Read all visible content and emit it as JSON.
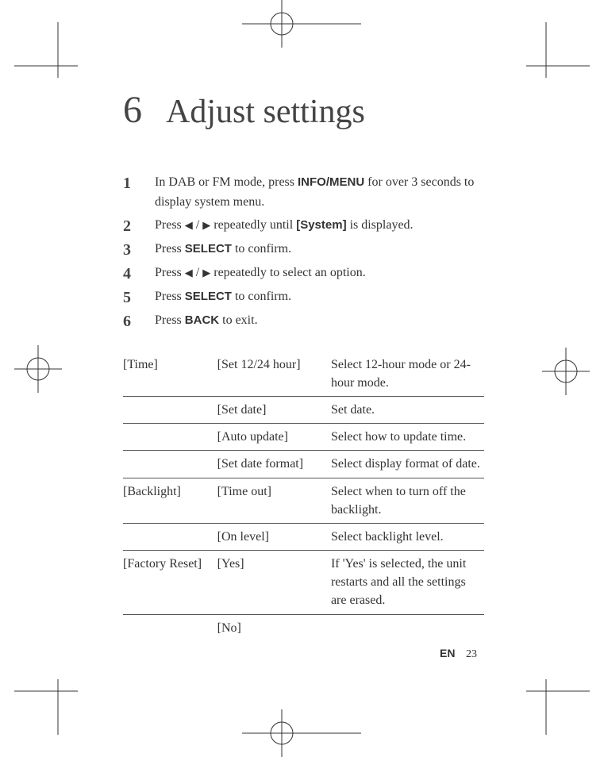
{
  "chapter": {
    "number": "6",
    "title": "Adjust settings"
  },
  "steps": [
    {
      "n": "1",
      "pre": "In DAB or FM mode, press ",
      "bold": "INFO/MENU",
      "post": " for over 3 seconds to display system menu."
    },
    {
      "n": "2",
      "pre": "Press ",
      "icons": true,
      "mid": " repeatedly until ",
      "bold": "[System]",
      "post": " is displayed."
    },
    {
      "n": "3",
      "pre": "Press ",
      "bold": "SELECT",
      "post": " to confirm."
    },
    {
      "n": "4",
      "pre": "Press ",
      "icons": true,
      "mid": " repeatedly to select an option.",
      "bold": "",
      "post": ""
    },
    {
      "n": "5",
      "pre": "Press ",
      "bold": "SELECT",
      "post": " to confirm."
    },
    {
      "n": "6",
      "pre": "Press ",
      "bold": "BACK",
      "post": " to exit."
    }
  ],
  "table": [
    {
      "cat": "[Time]",
      "opt": "[Set 12/24 hour]",
      "desc": "Select 12-hour mode or 24-hour mode."
    },
    {
      "cat": "",
      "opt": "[Set date]",
      "desc": "Set date."
    },
    {
      "cat": "",
      "opt": "[Auto update]",
      "desc": "Select how to update time."
    },
    {
      "cat": "",
      "opt": "[Set date format]",
      "desc": "Select display format of date."
    },
    {
      "cat": "[Backlight]",
      "opt": "[Time out]",
      "desc": "Select when to turn off the backlight."
    },
    {
      "cat": "",
      "opt": "[On level]",
      "desc": "Select backlight level."
    },
    {
      "cat": "[Factory Reset]",
      "opt": "[Yes]",
      "desc": "If 'Yes' is selected, the unit restarts and all the settings are erased."
    },
    {
      "cat": "",
      "opt": "[No]",
      "desc": ""
    }
  ],
  "footer": {
    "lang": "EN",
    "page": "23"
  },
  "icons": {
    "left": "◀",
    "sep": " / ",
    "right": "▶"
  }
}
